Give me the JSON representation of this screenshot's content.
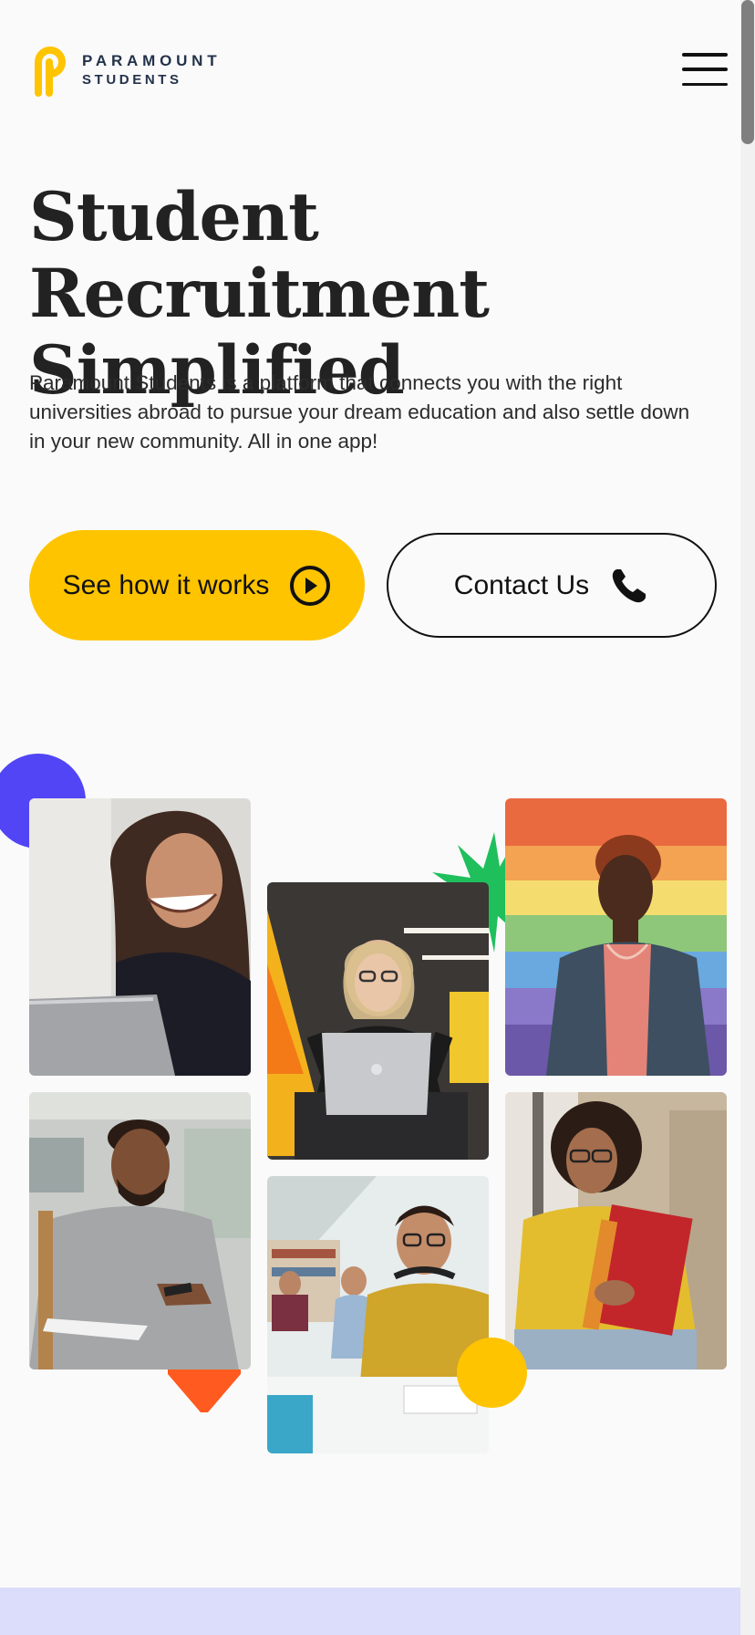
{
  "brand": {
    "name_line1": "PARAMOUNT",
    "name_line2": "STUDENTS",
    "logo_icon": "paramount-p-logo",
    "accent_color": "#ffc400"
  },
  "header": {
    "menu_icon": "hamburger-menu-icon"
  },
  "hero": {
    "title": "Student Recruitment Simplified",
    "description": "Paramount Students is a platform that connects you with the right universities abroad to pursue your dream education and also settle down in your new community. All in one app!",
    "primary_button": {
      "label": "See how it works",
      "icon": "play-circle-icon"
    },
    "secondary_button": {
      "label": "Contact Us",
      "icon": "phone-icon"
    }
  },
  "gallery": {
    "photos": [
      "laughing-student-with-laptop-photo",
      "excited-student-at-laptop-photo",
      "student-by-rainbow-wall-photo",
      "student-with-phone-photo",
      "student-with-headphones-in-library-photo",
      "student-holding-books-photo"
    ],
    "decor_colors": {
      "blue": "#5145f5",
      "green": "#1fbf5c",
      "orange": "#ff5a1f",
      "yellow": "#ffc400"
    }
  },
  "footer_band": {
    "color": "#dcdcfb"
  }
}
